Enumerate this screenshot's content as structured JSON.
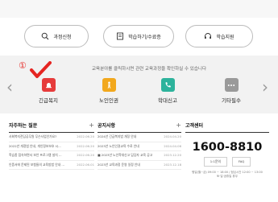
{
  "top_buttons": [
    {
      "label": "과정신청",
      "icon": "search-icon"
    },
    {
      "label": "학습하기/수료증",
      "icon": "certificate-icon"
    },
    {
      "label": "학습지원",
      "icon": "headset-icon"
    }
  ],
  "annotation": {
    "marker": "①"
  },
  "category": {
    "caption": "교육분야를 클릭하시면 관련 교육과정을 확인하실 수 있습니다",
    "items": [
      {
        "label": "긴급복지",
        "icon": "alarm-icon",
        "color": "#e63b3b"
      },
      {
        "label": "노인인권",
        "icon": "elderly-icon",
        "color": "#f2a81d"
      },
      {
        "label": "학대신고",
        "icon": "phone-icon",
        "color": "#2db39c"
      },
      {
        "label": "기타필수",
        "icon": "more-icon",
        "color": "#9a9a9a"
      }
    ]
  },
  "faq": {
    "title": "자주하는 질문",
    "items": [
      {
        "text": "사회복지전담공무원 무슨사업인가요?",
        "date": "2022.06.20"
      },
      {
        "text": "2022년 개정법 안내, 개인정보보호 시...",
        "date": "2022.06.20"
      },
      {
        "text": "학습종 접속하면서 보안 프로그램 설치 ...",
        "date": "2022.06.20"
      },
      {
        "text": "인증서에 문제된 보험들의 교육방법 안내 ...",
        "date": "2022.06.01"
      }
    ]
  },
  "notice": {
    "title": "공지사항",
    "items": [
      {
        "text": "2024년 긴급복지법 개정 안내",
        "date": "2024.04.20"
      },
      {
        "text": "2023년 노인인권교육 수료 안내",
        "date": "2024.04.06"
      },
      {
        "text": "■ 2023년 노인학대신고 담당자 교육 공고",
        "date": "2023.12.20"
      },
      {
        "text": "2023년 교육과정 운영 일정 안내",
        "date": "2023.12.18"
      }
    ]
  },
  "center": {
    "title": "고객센터",
    "phone": "1600-8810",
    "btn1": "1:1문의",
    "btn2": "FAQ",
    "hours_line1": "평일(월~금) 09:00 ~ 18:00 / 점심시간 12:00 ~ 13:00",
    "hours_line2": "토·일·공휴일 휴무"
  }
}
